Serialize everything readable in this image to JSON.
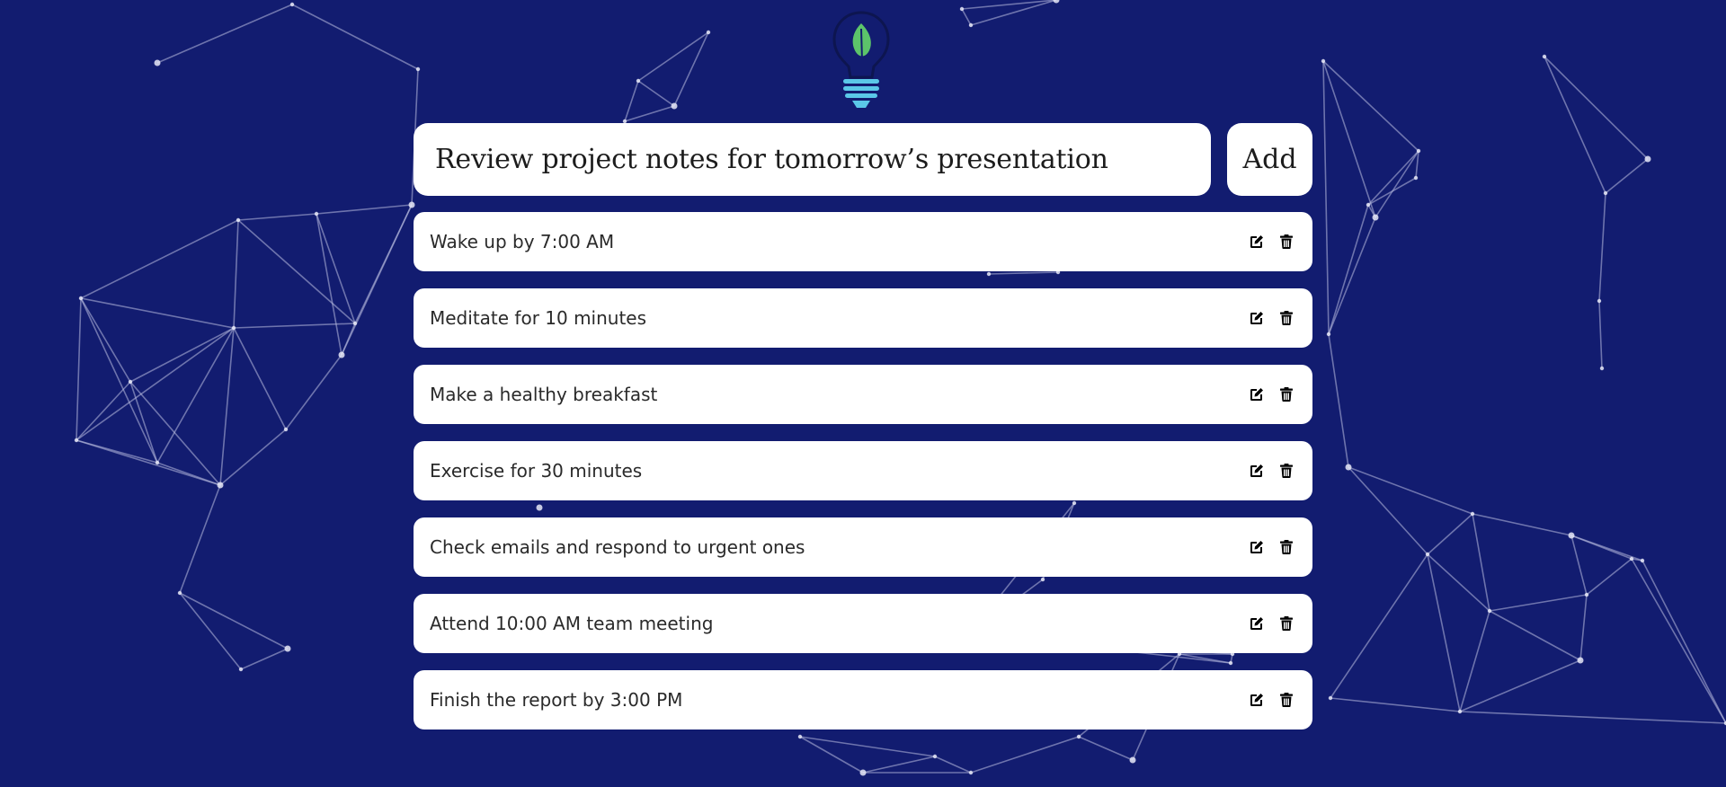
{
  "todo_input": {
    "value": "Review project notes for tomorrow’s presentation",
    "add_label": "Add"
  },
  "todos": [
    {
      "text": "Wake up by 7:00 AM"
    },
    {
      "text": "Meditate for 10 minutes"
    },
    {
      "text": "Make a healthy breakfast"
    },
    {
      "text": "Exercise for 30 minutes"
    },
    {
      "text": "Check emails and respond to urgent ones"
    },
    {
      "text": "Attend 10:00 AM team meeting"
    },
    {
      "text": "Finish the report by 3:00 PM"
    }
  ],
  "icons": {
    "logo": "lightbulb-leaf-icon",
    "edit": "edit-icon",
    "delete": "trash-icon"
  },
  "colors": {
    "background": "#121c70",
    "card": "#ffffff",
    "text": "#2a2a2a",
    "leaf": "#5cc46a",
    "bulb_base": "#5bc8e8",
    "network_lines": "#b9bee0"
  }
}
